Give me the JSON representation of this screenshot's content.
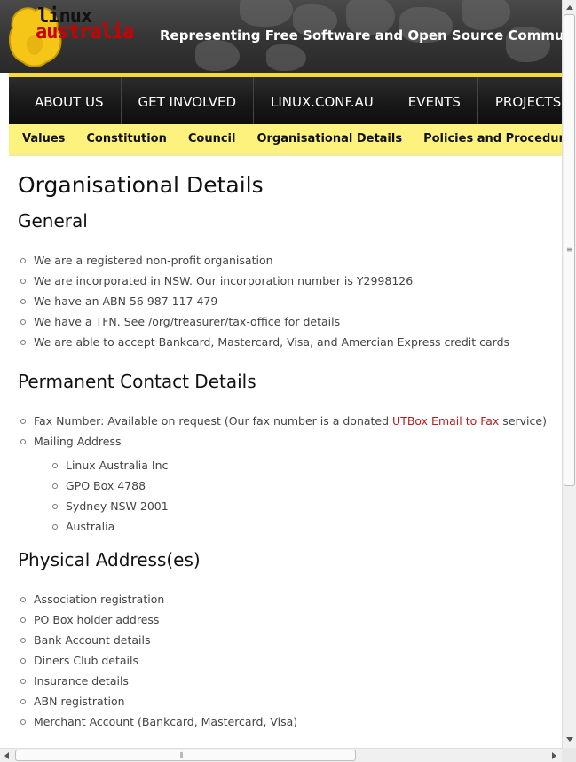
{
  "logo": {
    "line1": "linux",
    "line2": "australia"
  },
  "tagline": "Representing Free Software and Open Source Communities",
  "nav": {
    "items": [
      {
        "label": "ABOUT US"
      },
      {
        "label": "GET INVOLVED"
      },
      {
        "label": "LINUX.CONF.AU"
      },
      {
        "label": "EVENTS"
      },
      {
        "label": "PROJECTS"
      }
    ]
  },
  "subnav": {
    "items": [
      {
        "label": "Values"
      },
      {
        "label": "Constitution"
      },
      {
        "label": "Council"
      },
      {
        "label": "Organisational Details"
      },
      {
        "label": "Policies and Procedures"
      }
    ]
  },
  "page": {
    "title": "Organisational Details",
    "general": {
      "heading": "General",
      "items": [
        "We are a registered non-profit organisation",
        "We are incorporated in NSW. Our incorporation number is Y2998126",
        "We have an ABN 56 987 117 479",
        "We have a TFN. See /org/treasurer/tax-office for details",
        "We are able to accept Bankcard, Mastercard, Visa, and Amercian Express credit cards"
      ]
    },
    "contact": {
      "heading": "Permanent Contact Details",
      "fax_prefix": "Fax Number: Available on request (Our fax number is a donated ",
      "fax_link": "UTBox Email to Fax",
      "fax_suffix": " service)",
      "mailing_label": "Mailing Address",
      "address": [
        "Linux Australia Inc",
        "GPO Box 4788",
        "Sydney NSW 2001",
        "Australia"
      ]
    },
    "physical": {
      "heading": "Physical Address(es)",
      "items": [
        "Association registration",
        "PO Box holder address",
        "Bank Account details",
        "Diners Club details",
        "Insurance details",
        "ABN registration",
        "Merchant Account (Bankcard, Mastercard, Visa)"
      ]
    }
  },
  "colors": {
    "accent_yellow": "#fdf27e",
    "nav_dark": "#1a1a1a",
    "link_red": "#b81d1d"
  }
}
